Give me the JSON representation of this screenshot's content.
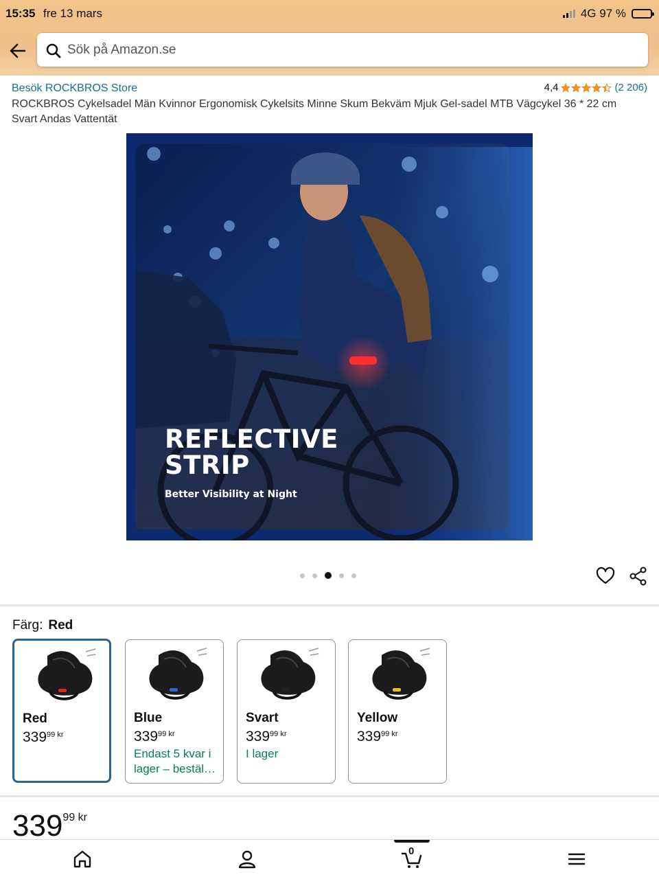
{
  "status_bar": {
    "time": "15:35",
    "date": "fre 13 mars",
    "network": "4G 97 %"
  },
  "search": {
    "placeholder": "Sök på Amazon.se"
  },
  "product": {
    "store_link": "Besök ROCKBROS Store",
    "rating_score": "4,4",
    "rating_stars": 4.4,
    "rating_count": "(2 206)",
    "title": "ROCKBROS Cykelsadel Män Kvinnor Ergonomisk Cykelsits Minne Skum Bekväm Mjuk Gel-sadel MTB Vägcykel 36 * 22 cm Svart Andas Vattentät"
  },
  "hero_image": {
    "headline": "REFLECTIVE STRIP",
    "subline": "Better Visibility at Night",
    "carousel_total": 5,
    "carousel_active": 3
  },
  "color": {
    "label": "Färg:",
    "selected": "Red"
  },
  "swatches": [
    {
      "name": "Red",
      "price_whole": "339",
      "price_frac": "99",
      "currency": "kr",
      "stock": "",
      "accent": "#d62a1f",
      "selected": true
    },
    {
      "name": "Blue",
      "price_whole": "339",
      "price_frac": "99",
      "currency": "kr",
      "stock": "Endast 5 kvar i lager – bestäl…",
      "accent": "#2a66d6",
      "selected": false
    },
    {
      "name": "Svart",
      "price_whole": "339",
      "price_frac": "99",
      "currency": "kr",
      "stock": "I lager",
      "accent": "#222222",
      "selected": false
    },
    {
      "name": "Yellow",
      "price_whole": "339",
      "price_frac": "99",
      "currency": "kr",
      "stock": "",
      "accent": "#e8c21a",
      "selected": false
    }
  ],
  "price": {
    "whole": "339",
    "frac": "99",
    "currency": "kr"
  },
  "bottom_nav": {
    "cart_count": "0"
  },
  "colors": {
    "header": "#f0c387",
    "link": "#1a6b9e",
    "star": "#ff9900",
    "in_stock": "#067d62",
    "selected_border": "#2a6496"
  }
}
